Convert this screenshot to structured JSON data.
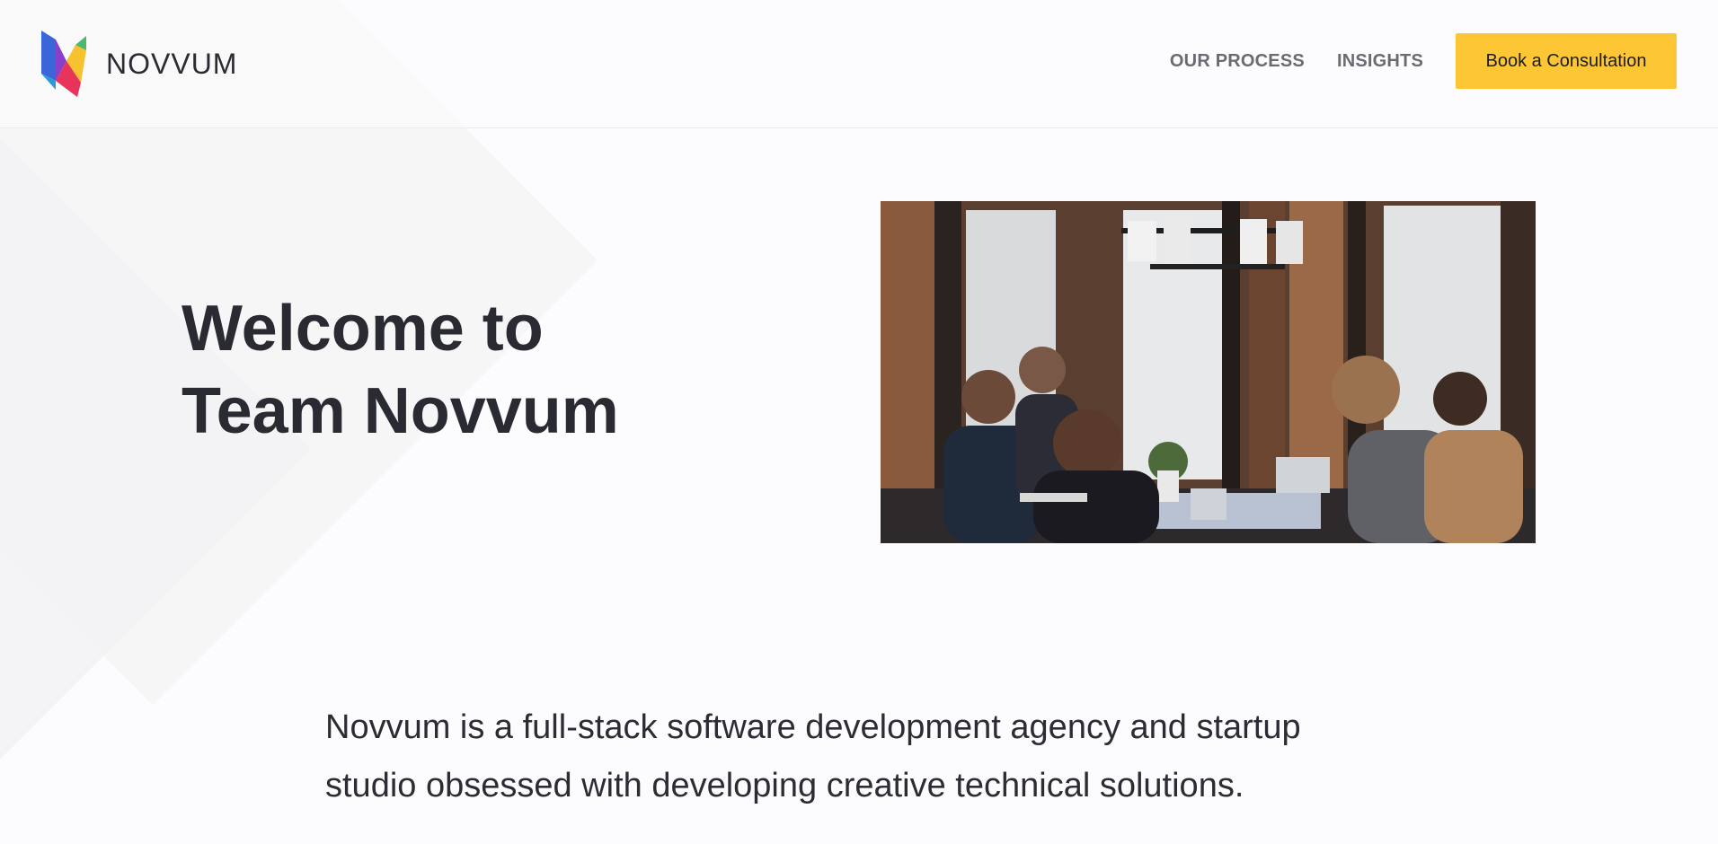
{
  "brand": {
    "name": "NOVVUM",
    "logo_icon": "novvum-logo-icon"
  },
  "nav": {
    "items": [
      {
        "label": "OUR PROCESS"
      },
      {
        "label": "INSIGHTS"
      }
    ],
    "cta_label": "Book a Consultation"
  },
  "hero": {
    "title_line1": "Welcome to",
    "title_line2": "Team Novvum",
    "image_subject": "team-working-at-table-photo"
  },
  "intro": {
    "text": "Novvum is a full-stack software development agency and startup studio obsessed with developing creative technical solutions."
  },
  "colors": {
    "accent": "#fcc634",
    "text": "#2a2a33",
    "nav_text": "#6a6a72",
    "background": "#fcfcfe"
  }
}
